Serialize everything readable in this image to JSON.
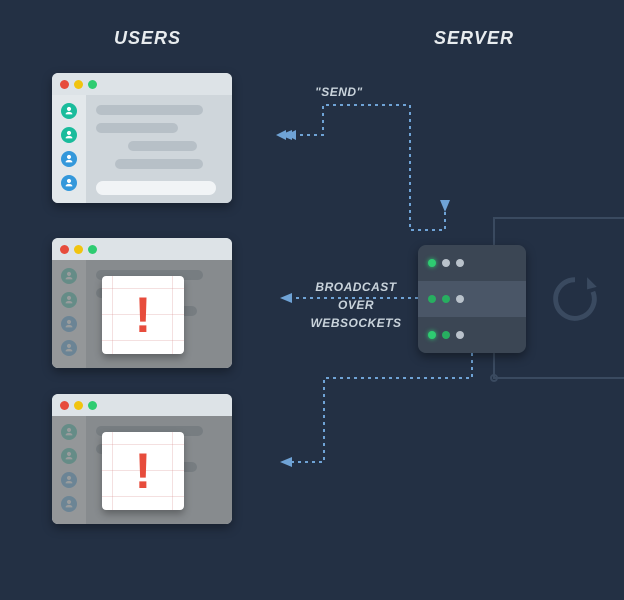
{
  "headings": {
    "users": "USERS",
    "server": "SERVER"
  },
  "labels": {
    "send": "\"SEND\"",
    "broadcast_line1": "BROADCAST OVER",
    "broadcast_line2": "WEBSOCKETS"
  },
  "alert_glyph": "!",
  "colors": {
    "bg": "#233044",
    "arrow": "#6fa3d6",
    "wire_dim": "#3a4a60",
    "alert": "#e74c3c"
  },
  "icons": {
    "refresh": "refresh-icon",
    "user": "user-icon",
    "exclamation": "exclamation-icon",
    "server_led_on": "led-on",
    "server_led_off": "led-off"
  }
}
